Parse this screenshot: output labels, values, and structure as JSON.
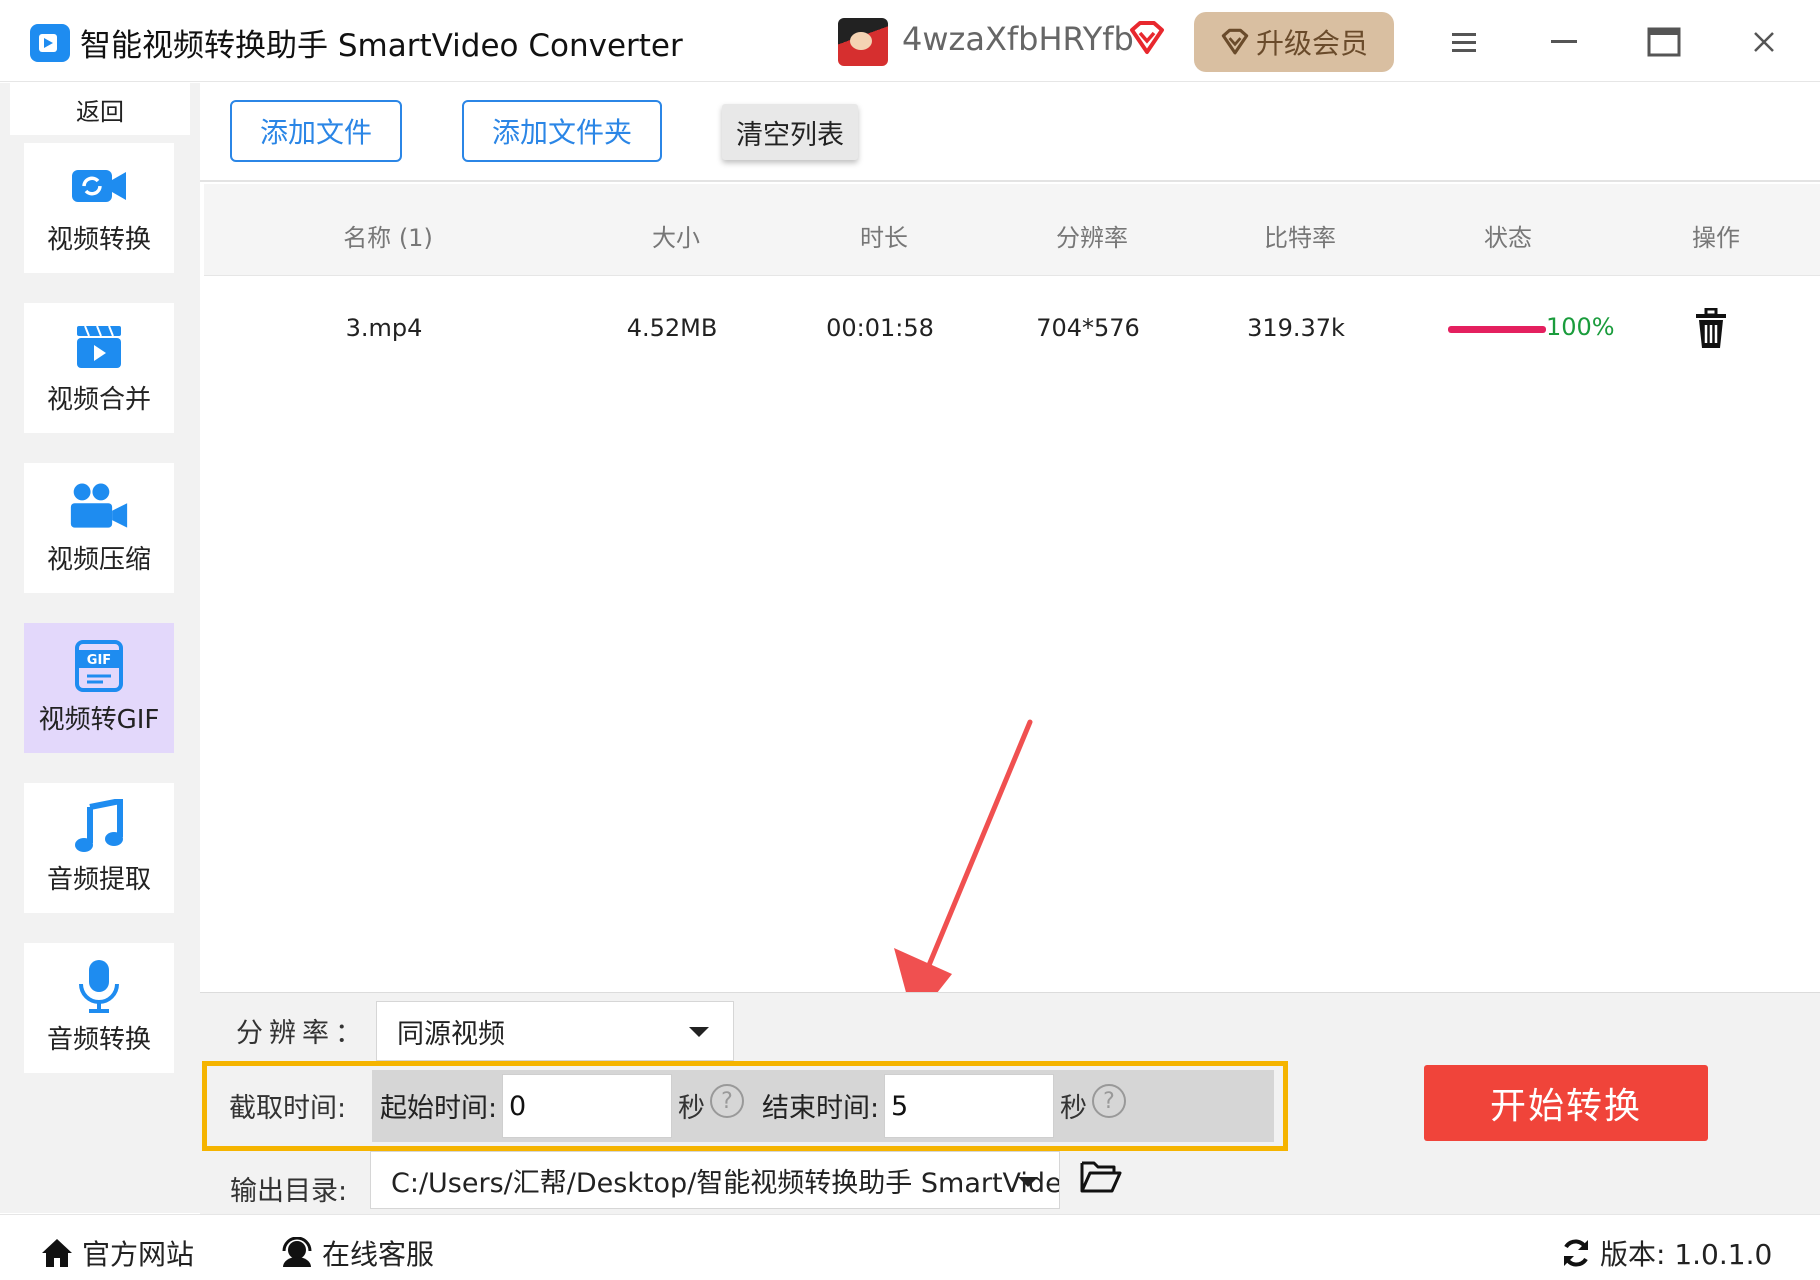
{
  "window": {
    "title": "智能视频转换助手 SmartVideo Converter",
    "username": "4wzaXfbHRYfb",
    "upgrade_label": "升级会员",
    "icons": [
      "menu-icon",
      "minimize-icon",
      "maximize-icon",
      "close-icon"
    ]
  },
  "sidebar": {
    "back_label": "返回",
    "items": [
      {
        "label": "视频转换",
        "icon": "video-convert-icon",
        "active": false
      },
      {
        "label": "视频合并",
        "icon": "video-merge-icon",
        "active": false
      },
      {
        "label": "视频压缩",
        "icon": "video-compress-icon",
        "active": false
      },
      {
        "label": "视频转GIF",
        "icon": "gif-icon",
        "active": true
      },
      {
        "label": "音频提取",
        "icon": "music-note-icon",
        "active": false
      },
      {
        "label": "音频转换",
        "icon": "microphone-icon",
        "active": false
      }
    ],
    "active_color": "#e3d8fb"
  },
  "toolbar": {
    "add_file": "添加文件",
    "add_folder": "添加文件夹",
    "clear_list": "清空列表"
  },
  "table": {
    "columns": [
      "名称 (1)",
      "大小",
      "时长",
      "分辨率",
      "比特率",
      "状态",
      "操作"
    ],
    "rows": [
      {
        "name": "3.mp4",
        "size": "4.52MB",
        "duration": "00:01:58",
        "resolution": "704*576",
        "bitrate": "319.37k",
        "progress": 1.0,
        "status_text": "100%",
        "action_icon": "trash-icon"
      }
    ]
  },
  "settings": {
    "resolution_label": "分辨率：",
    "resolution_value": "同源视频",
    "clip_label": "截取时间:",
    "start_label": "起始时间:",
    "start_value": "0",
    "end_label": "结束时间:",
    "end_value": "5",
    "unit": "秒",
    "help": "?",
    "output_label": "输出目录:",
    "output_value": "C:/Users/汇帮/Desktop/智能视频转换助手 SmartVideo Cor",
    "start_button": "开始转换"
  },
  "footer": {
    "website": "官方网站",
    "support": "在线客服",
    "version": "版本: 1.0.1.0"
  },
  "colors": {
    "accent_blue": "#2b86e6",
    "start_red": "#f0443a",
    "highlight_orange": "#f5b400",
    "progress_pink": "#e4205f",
    "progress_text_green": "#1a9c3c",
    "upgrade_bg": "#d9bfa1"
  }
}
